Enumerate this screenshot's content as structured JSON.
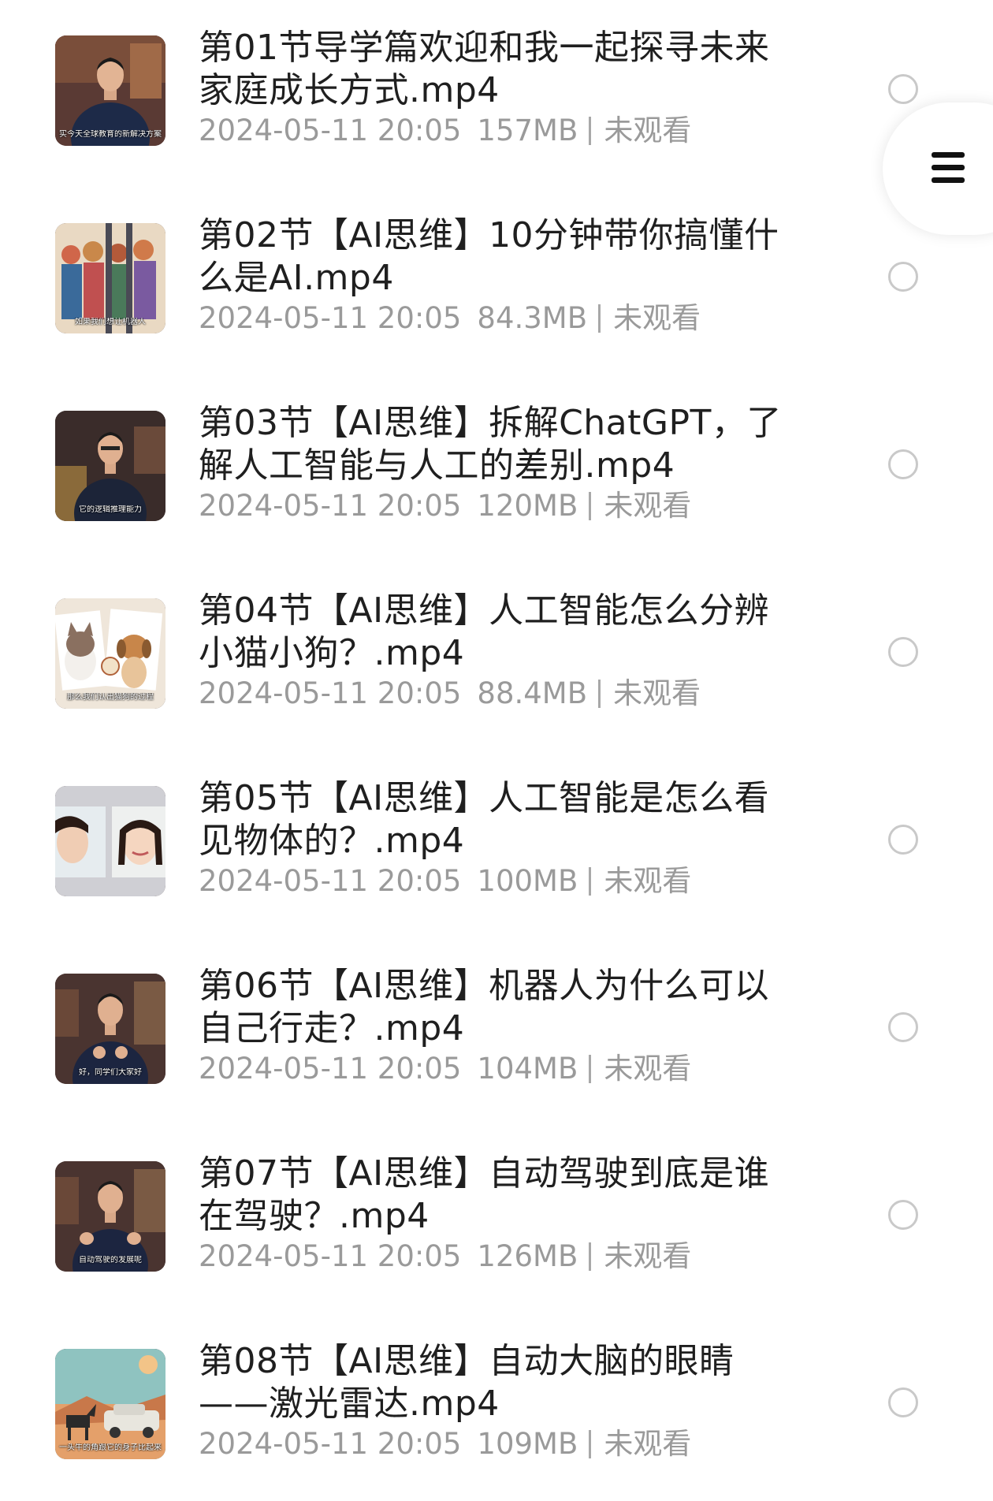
{
  "files": [
    {
      "title": "第01节导学篇欢迎和我一起探寻未来家庭成长方式.mp4",
      "date": "2024-05-11 20:05",
      "size": "157MB",
      "status": "未观看",
      "thumb_caption": "实今天全球教育的新解决方案"
    },
    {
      "title": "第02节【AI思维】10分钟带你搞懂什么是AI.mp4",
      "date": "2024-05-11 20:05",
      "size": "84.3MB",
      "status": "未观看",
      "thumb_caption": "如果我们想让机器人"
    },
    {
      "title": "第03节【AI思维】拆解ChatGPT，了解人工智能与人工的差别.mp4",
      "date": "2024-05-11 20:05",
      "size": "120MB",
      "status": "未观看",
      "thumb_caption": "它的逻辑推理能力"
    },
    {
      "title": "第04节【AI思维】人工智能怎么分辨小猫小狗？.mp4",
      "date": "2024-05-11 20:05",
      "size": "88.4MB",
      "status": "未观看",
      "thumb_caption": "那么我们认出猫狗的过程"
    },
    {
      "title": "第05节【AI思维】人工智能是怎么看见物体的？.mp4",
      "date": "2024-05-11 20:05",
      "size": "100MB",
      "status": "未观看",
      "thumb_caption": ""
    },
    {
      "title": "第06节【AI思维】机器人为什么可以自己行走？.mp4",
      "date": "2024-05-11 20:05",
      "size": "104MB",
      "status": "未观看",
      "thumb_caption": "好，同学们大家好"
    },
    {
      "title": "第07节【AI思维】自动驾驶到底是谁在驾驶？.mp4",
      "date": "2024-05-11 20:05",
      "size": "126MB",
      "status": "未观看",
      "thumb_caption": "自动驾驶的发展呢"
    },
    {
      "title": "第08节【AI思维】自动大脑的眼睛——激光雷达.mp4",
      "date": "2024-05-11 20:05",
      "size": "109MB",
      "status": "未观看",
      "thumb_caption": "一头牛的角跟它的身子比起来"
    }
  ],
  "menu": {
    "icon": "hamburger-menu-icon"
  },
  "colors": {
    "title": "#1f1f1f",
    "meta": "#9a9a9a",
    "radio_border": "#c9c9c9"
  }
}
